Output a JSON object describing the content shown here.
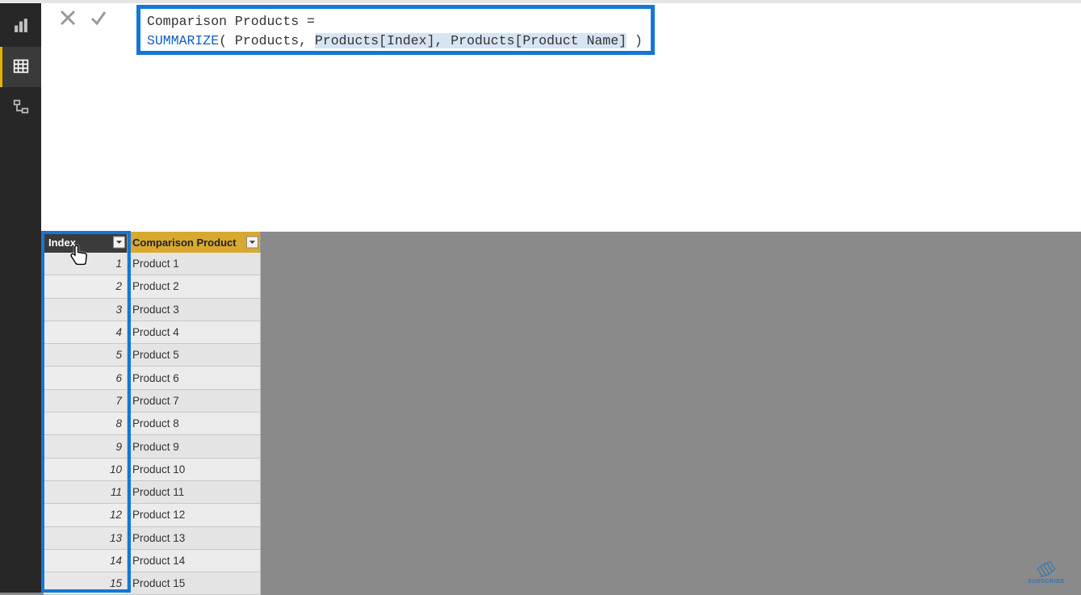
{
  "formula": {
    "line1_pre": "Comparison Products =",
    "line2_func": "SUMMARIZE",
    "line2_open": "( Products, ",
    "line2_sel": "Products[Index], Products[Product Name]",
    "line2_close": " )"
  },
  "table": {
    "headers": {
      "index": "Index",
      "product": "Comparison Product"
    },
    "rows": [
      {
        "index": "1",
        "product": "Product 1"
      },
      {
        "index": "2",
        "product": "Product 2"
      },
      {
        "index": "3",
        "product": "Product 3"
      },
      {
        "index": "4",
        "product": "Product 4"
      },
      {
        "index": "5",
        "product": "Product 5"
      },
      {
        "index": "6",
        "product": "Product 6"
      },
      {
        "index": "7",
        "product": "Product 7"
      },
      {
        "index": "8",
        "product": "Product 8"
      },
      {
        "index": "9",
        "product": "Product 9"
      },
      {
        "index": "10",
        "product": "Product 10"
      },
      {
        "index": "11",
        "product": "Product 11"
      },
      {
        "index": "12",
        "product": "Product 12"
      },
      {
        "index": "13",
        "product": "Product 13"
      },
      {
        "index": "14",
        "product": "Product 14"
      },
      {
        "index": "15",
        "product": "Product 15"
      }
    ]
  },
  "subscribe": {
    "label": "SUBSCRIBE"
  }
}
